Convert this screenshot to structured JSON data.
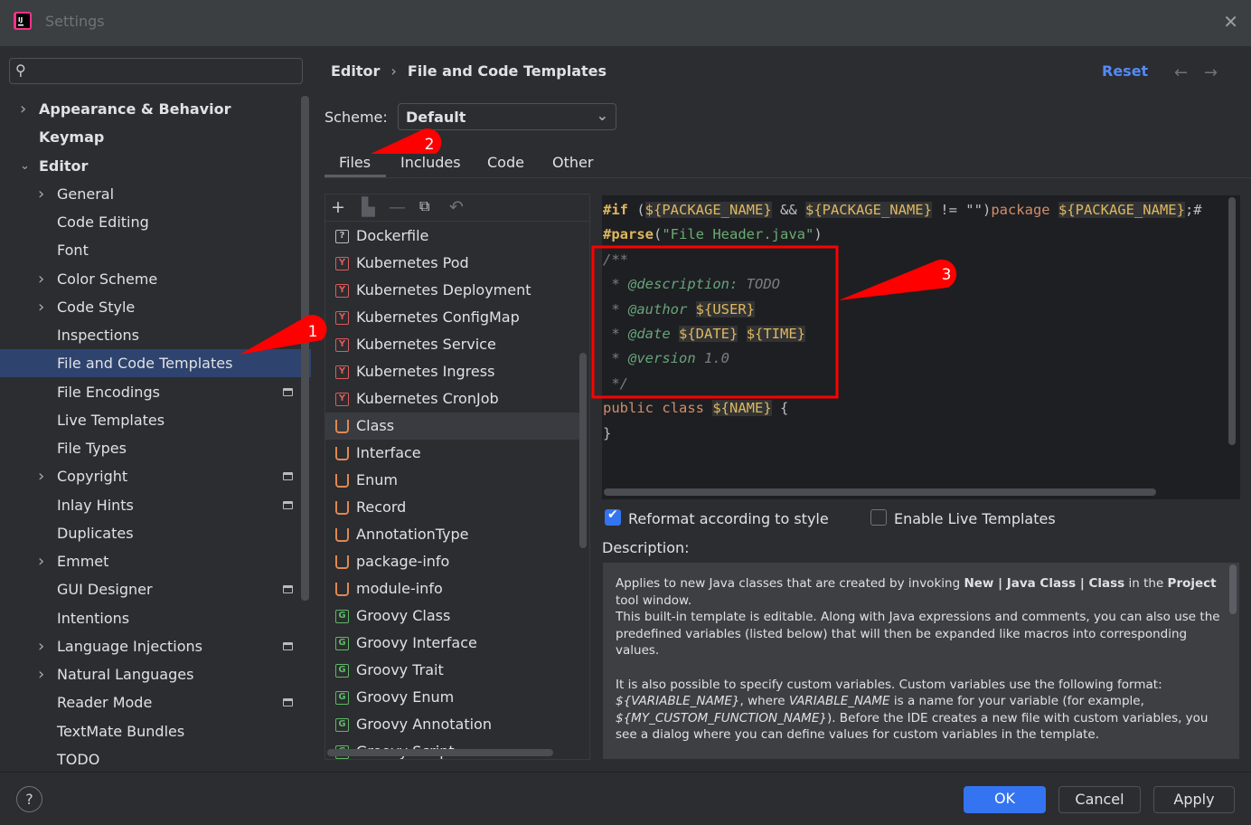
{
  "window": {
    "title": "Settings"
  },
  "search": {
    "placeholder": ""
  },
  "sidebar": {
    "items": [
      {
        "label": "Appearance & Behavior",
        "level": 0,
        "arrow": "collapsed",
        "project": false
      },
      {
        "label": "Keymap",
        "level": 0,
        "arrow": "none",
        "project": false
      },
      {
        "label": "Editor",
        "level": 0,
        "arrow": "expanded",
        "project": false
      },
      {
        "label": "General",
        "level": 1,
        "arrow": "collapsed",
        "project": false
      },
      {
        "label": "Code Editing",
        "level": 1,
        "arrow": "none",
        "project": false
      },
      {
        "label": "Font",
        "level": 1,
        "arrow": "none",
        "project": false
      },
      {
        "label": "Color Scheme",
        "level": 1,
        "arrow": "collapsed",
        "project": false
      },
      {
        "label": "Code Style",
        "level": 1,
        "arrow": "collapsed",
        "project": false
      },
      {
        "label": "Inspections",
        "level": 1,
        "arrow": "none",
        "project": false
      },
      {
        "label": "File and Code Templates",
        "level": 1,
        "arrow": "none",
        "project": false,
        "selected": true
      },
      {
        "label": "File Encodings",
        "level": 1,
        "arrow": "none",
        "project": true
      },
      {
        "label": "Live Templates",
        "level": 1,
        "arrow": "none",
        "project": false
      },
      {
        "label": "File Types",
        "level": 1,
        "arrow": "none",
        "project": false
      },
      {
        "label": "Copyright",
        "level": 1,
        "arrow": "collapsed",
        "project": true
      },
      {
        "label": "Inlay Hints",
        "level": 1,
        "arrow": "none",
        "project": true
      },
      {
        "label": "Duplicates",
        "level": 1,
        "arrow": "none",
        "project": false
      },
      {
        "label": "Emmet",
        "level": 1,
        "arrow": "collapsed",
        "project": false
      },
      {
        "label": "GUI Designer",
        "level": 1,
        "arrow": "none",
        "project": true
      },
      {
        "label": "Intentions",
        "level": 1,
        "arrow": "none",
        "project": false
      },
      {
        "label": "Language Injections",
        "level": 1,
        "arrow": "collapsed",
        "project": true
      },
      {
        "label": "Natural Languages",
        "level": 1,
        "arrow": "collapsed",
        "project": false
      },
      {
        "label": "Reader Mode",
        "level": 1,
        "arrow": "none",
        "project": true
      },
      {
        "label": "TextMate Bundles",
        "level": 1,
        "arrow": "none",
        "project": false
      },
      {
        "label": "TODO",
        "level": 1,
        "arrow": "none",
        "project": false
      }
    ]
  },
  "header": {
    "crumb_parent": "Editor",
    "crumb_sep": "›",
    "crumb_current": "File and Code Templates",
    "reset": "Reset",
    "back": "←",
    "forward": "→"
  },
  "scheme": {
    "label": "Scheme:",
    "value": "Default"
  },
  "tabs": [
    {
      "label": "Files",
      "active": true
    },
    {
      "label": "Includes"
    },
    {
      "label": "Code"
    },
    {
      "label": "Other"
    }
  ],
  "toolbar": {
    "add": "+",
    "remove": "—",
    "undo": "↶"
  },
  "files": [
    {
      "name": "Dockerfile",
      "icon": "?",
      "color": "#b8bcc2"
    },
    {
      "name": "Kubernetes Pod",
      "icon": "Y",
      "color": "#db5c5c"
    },
    {
      "name": "Kubernetes Deployment",
      "icon": "Y",
      "color": "#db5c5c"
    },
    {
      "name": "Kubernetes ConfigMap",
      "icon": "Y",
      "color": "#db5c5c"
    },
    {
      "name": "Kubernetes Service",
      "icon": "Y",
      "color": "#db5c5c"
    },
    {
      "name": "Kubernetes Ingress",
      "icon": "Y",
      "color": "#db5c5c"
    },
    {
      "name": "Kubernetes CronJob",
      "icon": "Y",
      "color": "#db5c5c"
    },
    {
      "name": "Class",
      "icon": "java",
      "color": "#e08855",
      "selected": true
    },
    {
      "name": "Interface",
      "icon": "java",
      "color": "#e08855"
    },
    {
      "name": "Enum",
      "icon": "java",
      "color": "#e08855"
    },
    {
      "name": "Record",
      "icon": "java",
      "color": "#e08855"
    },
    {
      "name": "AnnotationType",
      "icon": "java",
      "color": "#e08855"
    },
    {
      "name": "package-info",
      "icon": "java",
      "color": "#e08855"
    },
    {
      "name": "module-info",
      "icon": "java",
      "color": "#e08855"
    },
    {
      "name": "Groovy Class",
      "icon": "G",
      "color": "#5fb865"
    },
    {
      "name": "Groovy Interface",
      "icon": "G",
      "color": "#5fb865"
    },
    {
      "name": "Groovy Trait",
      "icon": "G",
      "color": "#5fb865"
    },
    {
      "name": "Groovy Enum",
      "icon": "G",
      "color": "#5fb865"
    },
    {
      "name": "Groovy Annotation",
      "icon": "G",
      "color": "#5fb865"
    },
    {
      "name": "Groovy Script",
      "icon": "G",
      "color": "#5fb865"
    }
  ],
  "code": [
    [
      {
        "t": "#if",
        "c": "dir"
      },
      {
        "t": " (",
        "c": "p"
      },
      {
        "t": "${PACKAGE_NAME}",
        "c": "var"
      },
      {
        "t": " && ",
        "c": "p"
      },
      {
        "t": "${PACKAGE_NAME}",
        "c": "var"
      },
      {
        "t": " != ",
        "c": "p"
      },
      {
        "t": "\"\"",
        "c": "p"
      },
      {
        "t": ")",
        "c": "p"
      },
      {
        "t": "package ",
        "c": "kw"
      },
      {
        "t": "${PACKAGE_NAME}",
        "c": "var"
      },
      {
        "t": ";#",
        "c": "p"
      }
    ],
    [
      {
        "t": "#parse",
        "c": "dir"
      },
      {
        "t": "(",
        "c": "p"
      },
      {
        "t": "\"File Header.java\"",
        "c": "str"
      },
      {
        "t": ")",
        "c": "p"
      }
    ],
    [
      {
        "t": "/**",
        "c": "cm"
      }
    ],
    [
      {
        "t": " * ",
        "c": "cm"
      },
      {
        "t": "@description:",
        "c": "tag"
      },
      {
        "t": " TODO",
        "c": "cm"
      }
    ],
    [
      {
        "t": " * ",
        "c": "cm"
      },
      {
        "t": "@author",
        "c": "tag"
      },
      {
        "t": " ",
        "c": "cm"
      },
      {
        "t": "${USER}",
        "c": "var"
      }
    ],
    [
      {
        "t": " * ",
        "c": "cm"
      },
      {
        "t": "@date",
        "c": "tag"
      },
      {
        "t": " ",
        "c": "cm"
      },
      {
        "t": "${DATE}",
        "c": "var"
      },
      {
        "t": " ",
        "c": "cm"
      },
      {
        "t": "${TIME}",
        "c": "var"
      }
    ],
    [
      {
        "t": " * ",
        "c": "cm"
      },
      {
        "t": "@version",
        "c": "tag"
      },
      {
        "t": " 1.0",
        "c": "cm"
      }
    ],
    [
      {
        "t": " */",
        "c": "cm"
      }
    ],
    [
      {
        "t": "public class ",
        "c": "kw"
      },
      {
        "t": "${NAME}",
        "c": "var"
      },
      {
        "t": " {",
        "c": "p"
      }
    ],
    [
      {
        "t": "}",
        "c": "p"
      }
    ]
  ],
  "code_colors": {
    "dir": "#e0b75e",
    "p": "#bcbec4",
    "var": "#e0b75e",
    "kw": "#cf8e6d",
    "str": "#6aab73",
    "cm": "#7a7e85",
    "tag": "#67a37c"
  },
  "options": {
    "reformat": {
      "label": "Reformat according to style",
      "checked": true
    },
    "live_templates": {
      "label": "Enable Live Templates",
      "checked": false
    }
  },
  "description": {
    "label": "Description:",
    "p1a": "Applies to new Java classes that are created by invoking ",
    "p1b": "New | Java Class | Class",
    "p1c": " in the ",
    "p1d": "Project",
    "p1e": " tool window.",
    "p2": "This built-in template is editable. Along with Java expressions and comments, you can also use the predefined variables (listed below) that will then be expanded like macros into corresponding values.",
    "p3a": "It is also possible to specify custom variables. Custom variables use the following format: ",
    "p3b": "${VARIABLE_NAME}",
    "p3c": ", where ",
    "p3d": "VARIABLE_NAME",
    "p3e": " is a name for your variable (for example, ",
    "p3f": "${MY_CUSTOM_FUNCTION_NAME}",
    "p3g": "). Before the IDE creates a new file with custom variables, you see a dialog where you can define values for custom variables in the template."
  },
  "footer": {
    "help": "?",
    "ok": "OK",
    "cancel": "Cancel",
    "apply": "Apply"
  },
  "annotations": [
    "1",
    "2",
    "3"
  ],
  "colors": {
    "accent": "#3574f0",
    "selection": "#2e436e",
    "annotation": "#ff0000"
  }
}
